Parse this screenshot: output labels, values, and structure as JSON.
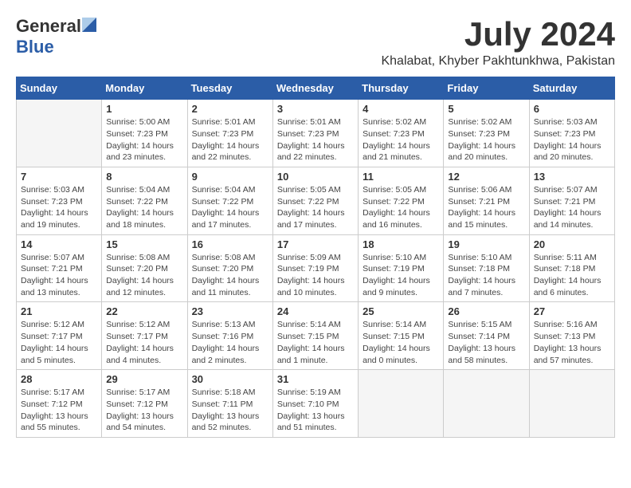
{
  "logo": {
    "general": "General",
    "blue": "Blue"
  },
  "title": "July 2024",
  "subtitle": "Khalabat, Khyber Pakhtunkhwa, Pakistan",
  "weekdays": [
    "Sunday",
    "Monday",
    "Tuesday",
    "Wednesday",
    "Thursday",
    "Friday",
    "Saturday"
  ],
  "weeks": [
    [
      {
        "day": "",
        "info": ""
      },
      {
        "day": "1",
        "info": "Sunrise: 5:00 AM\nSunset: 7:23 PM\nDaylight: 14 hours\nand 23 minutes."
      },
      {
        "day": "2",
        "info": "Sunrise: 5:01 AM\nSunset: 7:23 PM\nDaylight: 14 hours\nand 22 minutes."
      },
      {
        "day": "3",
        "info": "Sunrise: 5:01 AM\nSunset: 7:23 PM\nDaylight: 14 hours\nand 22 minutes."
      },
      {
        "day": "4",
        "info": "Sunrise: 5:02 AM\nSunset: 7:23 PM\nDaylight: 14 hours\nand 21 minutes."
      },
      {
        "day": "5",
        "info": "Sunrise: 5:02 AM\nSunset: 7:23 PM\nDaylight: 14 hours\nand 20 minutes."
      },
      {
        "day": "6",
        "info": "Sunrise: 5:03 AM\nSunset: 7:23 PM\nDaylight: 14 hours\nand 20 minutes."
      }
    ],
    [
      {
        "day": "7",
        "info": "Sunrise: 5:03 AM\nSunset: 7:23 PM\nDaylight: 14 hours\nand 19 minutes."
      },
      {
        "day": "8",
        "info": "Sunrise: 5:04 AM\nSunset: 7:22 PM\nDaylight: 14 hours\nand 18 minutes."
      },
      {
        "day": "9",
        "info": "Sunrise: 5:04 AM\nSunset: 7:22 PM\nDaylight: 14 hours\nand 17 minutes."
      },
      {
        "day": "10",
        "info": "Sunrise: 5:05 AM\nSunset: 7:22 PM\nDaylight: 14 hours\nand 17 minutes."
      },
      {
        "day": "11",
        "info": "Sunrise: 5:05 AM\nSunset: 7:22 PM\nDaylight: 14 hours\nand 16 minutes."
      },
      {
        "day": "12",
        "info": "Sunrise: 5:06 AM\nSunset: 7:21 PM\nDaylight: 14 hours\nand 15 minutes."
      },
      {
        "day": "13",
        "info": "Sunrise: 5:07 AM\nSunset: 7:21 PM\nDaylight: 14 hours\nand 14 minutes."
      }
    ],
    [
      {
        "day": "14",
        "info": "Sunrise: 5:07 AM\nSunset: 7:21 PM\nDaylight: 14 hours\nand 13 minutes."
      },
      {
        "day": "15",
        "info": "Sunrise: 5:08 AM\nSunset: 7:20 PM\nDaylight: 14 hours\nand 12 minutes."
      },
      {
        "day": "16",
        "info": "Sunrise: 5:08 AM\nSunset: 7:20 PM\nDaylight: 14 hours\nand 11 minutes."
      },
      {
        "day": "17",
        "info": "Sunrise: 5:09 AM\nSunset: 7:19 PM\nDaylight: 14 hours\nand 10 minutes."
      },
      {
        "day": "18",
        "info": "Sunrise: 5:10 AM\nSunset: 7:19 PM\nDaylight: 14 hours\nand 9 minutes."
      },
      {
        "day": "19",
        "info": "Sunrise: 5:10 AM\nSunset: 7:18 PM\nDaylight: 14 hours\nand 7 minutes."
      },
      {
        "day": "20",
        "info": "Sunrise: 5:11 AM\nSunset: 7:18 PM\nDaylight: 14 hours\nand 6 minutes."
      }
    ],
    [
      {
        "day": "21",
        "info": "Sunrise: 5:12 AM\nSunset: 7:17 PM\nDaylight: 14 hours\nand 5 minutes."
      },
      {
        "day": "22",
        "info": "Sunrise: 5:12 AM\nSunset: 7:17 PM\nDaylight: 14 hours\nand 4 minutes."
      },
      {
        "day": "23",
        "info": "Sunrise: 5:13 AM\nSunset: 7:16 PM\nDaylight: 14 hours\nand 2 minutes."
      },
      {
        "day": "24",
        "info": "Sunrise: 5:14 AM\nSunset: 7:15 PM\nDaylight: 14 hours\nand 1 minute."
      },
      {
        "day": "25",
        "info": "Sunrise: 5:14 AM\nSunset: 7:15 PM\nDaylight: 14 hours\nand 0 minutes."
      },
      {
        "day": "26",
        "info": "Sunrise: 5:15 AM\nSunset: 7:14 PM\nDaylight: 13 hours\nand 58 minutes."
      },
      {
        "day": "27",
        "info": "Sunrise: 5:16 AM\nSunset: 7:13 PM\nDaylight: 13 hours\nand 57 minutes."
      }
    ],
    [
      {
        "day": "28",
        "info": "Sunrise: 5:17 AM\nSunset: 7:12 PM\nDaylight: 13 hours\nand 55 minutes."
      },
      {
        "day": "29",
        "info": "Sunrise: 5:17 AM\nSunset: 7:12 PM\nDaylight: 13 hours\nand 54 minutes."
      },
      {
        "day": "30",
        "info": "Sunrise: 5:18 AM\nSunset: 7:11 PM\nDaylight: 13 hours\nand 52 minutes."
      },
      {
        "day": "31",
        "info": "Sunrise: 5:19 AM\nSunset: 7:10 PM\nDaylight: 13 hours\nand 51 minutes."
      },
      {
        "day": "",
        "info": ""
      },
      {
        "day": "",
        "info": ""
      },
      {
        "day": "",
        "info": ""
      }
    ]
  ]
}
